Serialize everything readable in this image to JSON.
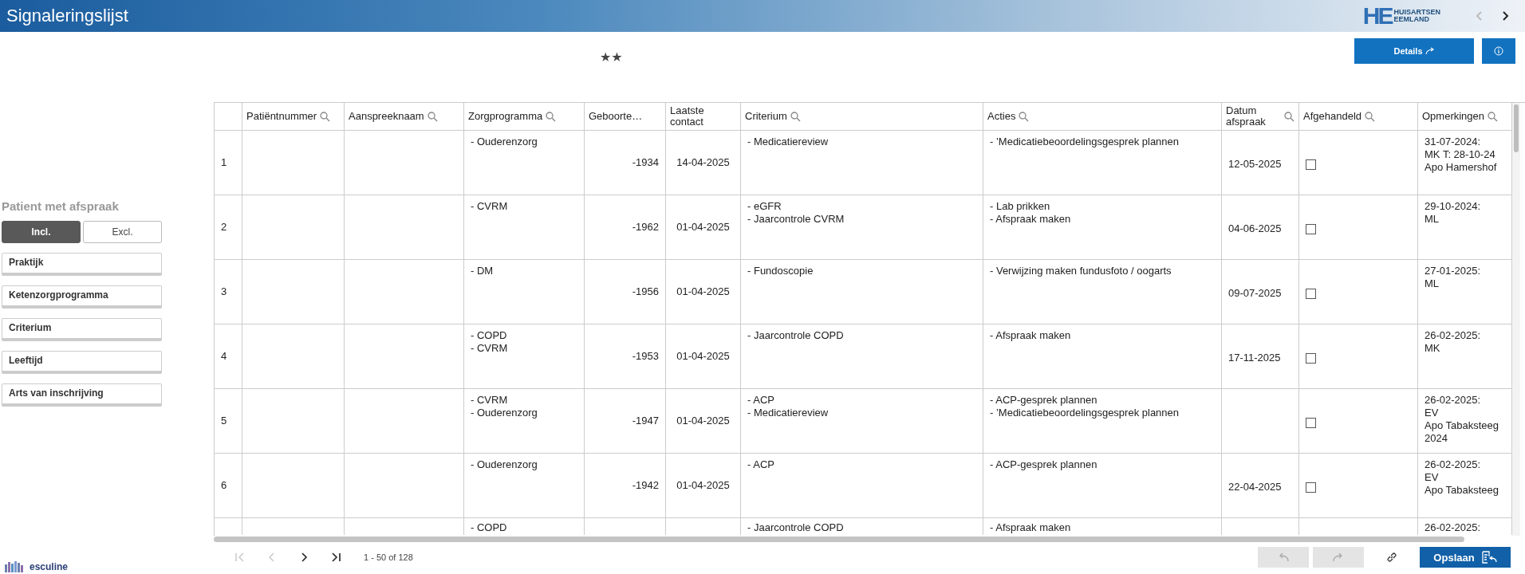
{
  "header": {
    "title": "Signaleringslijst",
    "logo": {
      "letters": "HE",
      "line1": "HUISARTSEN",
      "line2": "EEMLAND"
    },
    "nav": [
      {
        "kind": "prev",
        "disabled": true
      },
      {
        "kind": "next",
        "disabled": false
      }
    ]
  },
  "toolbar": {
    "stars": "★★",
    "details_button": "Details"
  },
  "filter_panel": {
    "title": "Patient met afspraak",
    "toggle": [
      {
        "label": "Incl.",
        "selected": true
      },
      {
        "label": "Excl.",
        "selected": false
      }
    ],
    "filters": [
      "Praktijk",
      "Ketenzorgprogramma",
      "Criterium",
      "Leeftijd",
      "Arts van inschrijving"
    ]
  },
  "table": {
    "columns": [
      {
        "kind": "index"
      },
      {
        "kind": "data",
        "label": "Patiëntnummer",
        "search": true
      },
      {
        "kind": "data",
        "label": "Aanspreeknaam",
        "search": true
      },
      {
        "kind": "data",
        "label": "Zorgprogramma",
        "search": true
      },
      {
        "kind": "data",
        "label": "Geboorte…",
        "search": false
      },
      {
        "kind": "data",
        "label": "Laatste contact",
        "search": false
      },
      {
        "kind": "data",
        "label": "Criterium",
        "search": true
      },
      {
        "kind": "data",
        "label": "Acties",
        "search": true
      },
      {
        "kind": "data",
        "label": "Datum afspraak",
        "search": true
      },
      {
        "kind": "data",
        "label": "Afgehandeld",
        "search": true
      },
      {
        "kind": "data",
        "label": "Opmerkingen",
        "search": true
      }
    ],
    "rows": [
      {
        "index": "1",
        "zorgprogramma": [
          "- Ouderenzorg"
        ],
        "geboortedatum": "-1934",
        "laatste_contact": "14-04-2025",
        "criterium": [
          "- Medicatiereview"
        ],
        "acties": [
          "- ’Medicatiebeoordelingsgesprek plannen"
        ],
        "datum_afspraak": "12-05-2025",
        "afgehandeld": false,
        "opmerkingen": [
          "31-07-2024:",
          "MK T: 28-10-24",
          "Apo Hamershof"
        ]
      },
      {
        "index": "2",
        "zorgprogramma": [
          "- CVRM"
        ],
        "geboortedatum": "-1962",
        "laatste_contact": "01-04-2025",
        "criterium": [
          "- eGFR",
          "- Jaarcontrole CVRM"
        ],
        "acties": [
          "- Lab prikken",
          "- Afspraak maken"
        ],
        "datum_afspraak": "04-06-2025",
        "afgehandeld": false,
        "opmerkingen": [
          "29-10-2024:",
          "ML"
        ]
      },
      {
        "index": "3",
        "zorgprogramma": [
          "- DM"
        ],
        "geboortedatum": "-1956",
        "laatste_contact": "01-04-2025",
        "criterium": [
          "- Fundoscopie"
        ],
        "acties": [
          "- Verwijzing maken fundusfoto / oogarts"
        ],
        "datum_afspraak": "09-07-2025",
        "afgehandeld": false,
        "opmerkingen": [
          "27-01-2025:",
          "ML"
        ]
      },
      {
        "index": "4",
        "zorgprogramma": [
          "- COPD",
          "- CVRM"
        ],
        "geboortedatum": "-1953",
        "laatste_contact": "01-04-2025",
        "criterium": [
          "- Jaarcontrole COPD"
        ],
        "acties": [
          "- Afspraak maken"
        ],
        "datum_afspraak": "17-11-2025",
        "afgehandeld": false,
        "opmerkingen": [
          "26-02-2025:",
          "MK"
        ]
      },
      {
        "index": "5",
        "zorgprogramma": [
          "- CVRM",
          "- Ouderenzorg"
        ],
        "geboortedatum": "-1947",
        "laatste_contact": "01-04-2025",
        "criterium": [
          "- ACP",
          "- Medicatiereview"
        ],
        "acties": [
          "- ACP-gesprek plannen",
          "- ’Medicatiebeoordelingsgesprek plannen"
        ],
        "afgehandeld": false,
        "opmerkingen": [
          "26-02-2025:",
          "EV",
          "Apo Tabaksteeg",
          "2024"
        ]
      },
      {
        "index": "6",
        "zorgprogramma": [
          "- Ouderenzorg"
        ],
        "geboortedatum": "-1942",
        "laatste_contact": "01-04-2025",
        "criterium": [
          "- ACP"
        ],
        "acties": [
          "- ACP-gesprek plannen"
        ],
        "datum_afspraak": "22-04-2025",
        "afgehandeld": false,
        "opmerkingen": [
          "26-02-2025:",
          "EV",
          "Apo Tabaksteeg"
        ]
      },
      {
        "partial": true,
        "zorgprogramma": [
          "- COPD"
        ],
        "criterium": [
          "- Jaarcontrole COPD"
        ],
        "acties": [
          "- Afspraak maken"
        ],
        "opmerkingen": [
          "26-02-2025:"
        ]
      }
    ]
  },
  "pagination": {
    "range": "1 - 50 of 128",
    "buttons": [
      {
        "kind": "first",
        "disabled": true
      },
      {
        "kind": "prev",
        "disabled": true
      },
      {
        "kind": "next",
        "disabled": false
      },
      {
        "kind": "last",
        "disabled": false
      }
    ]
  },
  "actions": {
    "undo_disabled": true,
    "redo_disabled": true,
    "save": "Opslaan"
  },
  "brand": "esculine"
}
